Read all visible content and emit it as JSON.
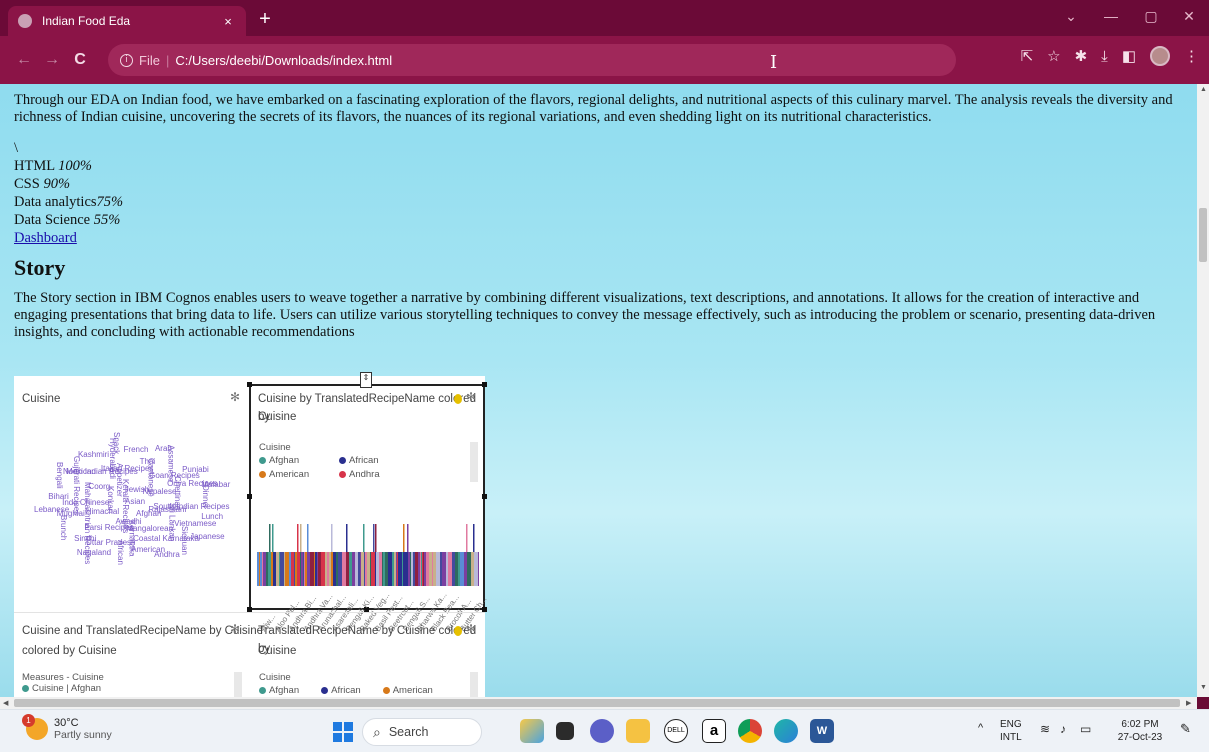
{
  "browser": {
    "tab_title": "Indian Food Eda",
    "tab_close": "×",
    "new_tab": "+",
    "address_protocol": "File",
    "address_path": "C:/Users/deebi/Downloads/index.html"
  },
  "page": {
    "intro": "Through our EDA on Indian food, we have embarked on a fascinating exploration of the flavors, regional delights, and nutritional aspects of this culinary marvel. The analysis reveals the diversity and richness of Indian cuisine, uncovering the secrets of its flavors, the nuances of its regional variations, and even shedding light on its nutritional characteristics.",
    "backslash": "\\",
    "skills": [
      {
        "name": "HTML ",
        "value": "100%"
      },
      {
        "name": "CSS ",
        "value": "90%"
      },
      {
        "name": "Data analytics",
        "value": "75%"
      },
      {
        "name": "Data Science ",
        "value": "55%"
      }
    ],
    "dashboard_link": "Dashboard",
    "story_heading": "Story",
    "story_text": "The Story section in IBM Cognos enables users to weave together a narrative by combining different visualizations, text descriptions, and annotations. It allows for the creation of interactive and engaging presentations that bring data to life. Users can utilize various storytelling techniques to convey the message effectively, such as introducing the problem or scenario, presenting data-driven insights, and concluding with actionable recommendations"
  },
  "dashboard": {
    "panel1_title": "Cuisine",
    "panel2_title_line1": "Cuisine by TranslatedRecipeName colored by",
    "panel2_title_line2": "Cuisine",
    "panel2_legend_title": "Cuisine",
    "panel2_legend": [
      {
        "label": "Afghan",
        "color": "#3f9a8e"
      },
      {
        "label": "African",
        "color": "#2a2f8f"
      },
      {
        "label": "American",
        "color": "#d7791a"
      },
      {
        "label": "Andhra",
        "color": "#d7344a"
      }
    ],
    "panel3_title_line1": "Cuisine and TranslatedRecipeName by Cuisine",
    "panel3_title_line2": "colored by Cuisine",
    "panel3_legend_title": "Measures - Cuisine",
    "panel3_legend_item": "Cuisine | Afghan",
    "panel4_title_line1": "TranslatedRecipeName by Cuisine colored by",
    "panel4_title_line2": "Cuisine",
    "panel4_legend_title": "Cuisine",
    "panel4_legend": [
      {
        "label": "Afghan",
        "color": "#3f9a8e"
      },
      {
        "label": "African",
        "color": "#2a2f8f"
      },
      {
        "label": "American",
        "color": "#d7791a"
      }
    ],
    "x_ticks": [
      "Ajw...",
      "Aloo Pel...",
      "Andhra Bi...",
      "Andhra Va...",
      "Arunachal...",
      "Asaresali...",
      "Bengali Ki...",
      "Baked Veg...",
      "Basil Pest...",
      "Beetroot...",
      "Bengali S...",
      "Bharwa Ka...",
      "Black Bea...",
      "Brocoli A...",
      "Butter Ch..."
    ],
    "cloud_words": [
      "Asian",
      "Kerala Recipes",
      "Jewish",
      "Afghan",
      "Konkan",
      "Nepalese",
      "Awadhi",
      "Appetizer",
      "Rajasthani",
      "Himachal",
      "Cantonese",
      "Mangalorean",
      "Coorg",
      "Chettinad",
      "Parsi Recipes",
      "Italian Recipes",
      "Sri Lankan",
      "Indo Chinese",
      "Goan Recipes",
      "Karnataka",
      "North Indian Recipes",
      "South Indian Recipes",
      "Maharashtrian Recipes",
      "Thai",
      "Coastal Karnataka",
      "Gujarati Recipes",
      "Oriya Recipes",
      "Uttar Pradesh",
      "Hyderabadi",
      "Vietnamese",
      "Mughlai",
      "Assamese",
      "American",
      "Mexican",
      "Dinner",
      "Sindhi",
      "French",
      "Sichuan",
      "Bihari",
      "Punjabi",
      "African",
      "Kashmiri",
      "Lunch",
      "Brunch",
      "Arab",
      "Andhra",
      "Bengali",
      "Malabar",
      "Nagaland",
      "Snack",
      "Japanese",
      "Lebanese"
    ]
  },
  "taskbar": {
    "temp": "30°C",
    "weather": "Partly sunny",
    "notifications": "1",
    "search": "Search",
    "lang1": "ENG",
    "lang2": "INTL",
    "time": "6:02 PM",
    "date": "27-Oct-23"
  }
}
